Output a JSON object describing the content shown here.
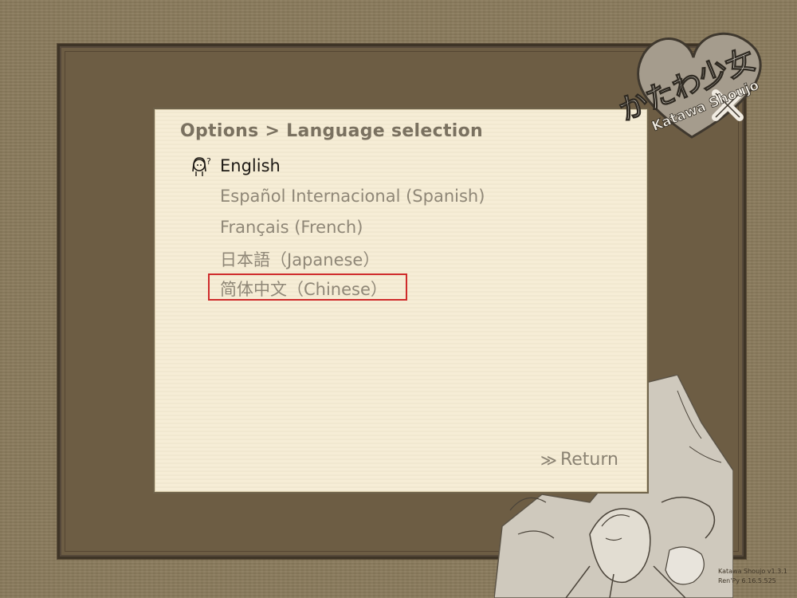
{
  "header": {
    "title": "Options > Language selection"
  },
  "languages": [
    {
      "label": "English",
      "selected": true
    },
    {
      "label": "Español Internacional (Spanish)",
      "selected": false
    },
    {
      "label": "Français (French)",
      "selected": false
    },
    {
      "label": "日本語（Japanese）",
      "selected": false
    },
    {
      "label": "简体中文（Chinese）",
      "selected": false
    }
  ],
  "cursor": {
    "icon": "girl-question-icon",
    "glyph": "?"
  },
  "footer": {
    "return_label": "Return",
    "return_arrow": "≫"
  },
  "logo": {
    "text_jp": "かたわ少女",
    "text_en": "Katawa Shoujo"
  },
  "version": {
    "line1": "Katawa Shoujo v1.3.1",
    "line2": "Ren'Py 6.16.5.525"
  },
  "colors": {
    "background": "#8a7a5c",
    "frame": "#6d5d44",
    "panel": "#f6edd6",
    "text_selected": "#1e1a15",
    "text_normal": "#8f8777",
    "highlight_box": "#cf2b2b"
  }
}
